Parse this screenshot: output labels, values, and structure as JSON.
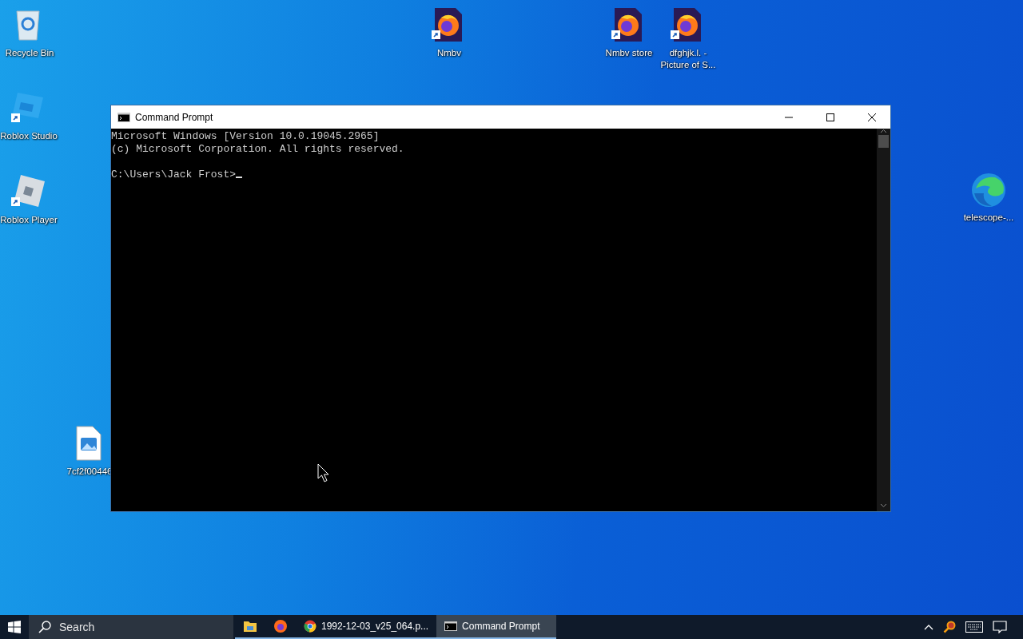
{
  "desktop_icons": [
    {
      "label": "Recycle Bin",
      "kind": "recycle",
      "shortcut": false
    },
    {
      "label": "Roblox Studio",
      "kind": "studio",
      "shortcut": true
    },
    {
      "label": "Roblox Player",
      "kind": "player",
      "shortcut": true
    },
    {
      "label": "7cf2f00446",
      "kind": "image",
      "shortcut": false
    },
    {
      "label": "Nmbv",
      "kind": "firefox",
      "shortcut": true
    },
    {
      "label": "Nmbv store",
      "kind": "firefox",
      "shortcut": true
    },
    {
      "label": "dfghjk.l. - Picture of S...",
      "kind": "firefox",
      "shortcut": true
    },
    {
      "label": "telescope-...",
      "kind": "edge",
      "shortcut": false
    }
  ],
  "window": {
    "title": "Command Prompt",
    "console_blocks": [
      [
        "Microsoft Windows [Version 10.0.19045.2965]",
        "(c) Microsoft Corporation. All rights reserved."
      ],
      [
        "C:\\Users\\Jack Frost>"
      ]
    ],
    "cursor": true
  },
  "taskbar": {
    "search": {
      "placeholder": "Search"
    },
    "apps": [
      {
        "kind": "explorer",
        "selected": false
      },
      {
        "kind": "firefox",
        "selected": false
      },
      {
        "kind": "chrome",
        "label": "1992-12-03_v25_064.p...",
        "selected": false
      },
      {
        "kind": "cmd",
        "label": "Command Prompt",
        "selected": true
      }
    ]
  }
}
